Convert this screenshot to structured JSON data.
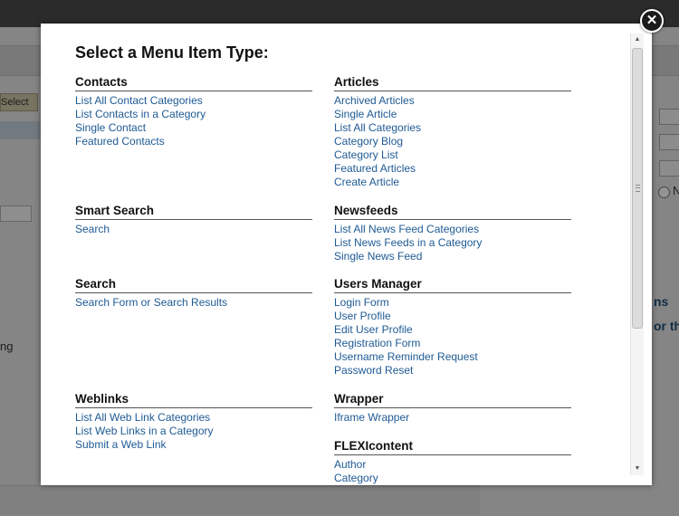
{
  "background": {
    "select_button_label": "Select",
    "left_fragment_text": "ng",
    "right_fragment_1": "ns",
    "right_fragment_2": "or th",
    "radio_label": "N"
  },
  "modal": {
    "title": "Select a Menu Item Type:",
    "close_glyph": "✕",
    "left_column": [
      {
        "heading": "Contacts",
        "items": [
          "List All Contact Categories",
          "List Contacts in a Category",
          "Single Contact",
          "Featured Contacts"
        ]
      },
      {
        "heading": "Smart Search",
        "items": [
          "Search"
        ]
      },
      {
        "heading": "Search",
        "items": [
          "Search Form or Search Results"
        ]
      },
      {
        "heading": "Weblinks",
        "items": [
          "List All Web Link Categories",
          "List Web Links in a Category",
          "Submit a Web Link"
        ]
      }
    ],
    "right_column": [
      {
        "heading": "Articles",
        "items": [
          "Archived Articles",
          "Single Article",
          "List All Categories",
          "Category Blog",
          "Category List",
          "Featured Articles",
          "Create Article"
        ]
      },
      {
        "heading": "Newsfeeds",
        "items": [
          "List All News Feed Categories",
          "List News Feeds in a Category",
          "Single News Feed"
        ]
      },
      {
        "heading": "Users Manager",
        "items": [
          "Login Form",
          "User Profile",
          "Edit User Profile",
          "Registration Form",
          "Username Reminder Request",
          "Password Reset"
        ]
      },
      {
        "heading": "Wrapper",
        "items": [
          "Iframe Wrapper"
        ]
      },
      {
        "heading": "FLEXIcontent",
        "items": [
          "Author",
          "Category"
        ]
      }
    ]
  },
  "scrollbar": {
    "up_glyph": "▲",
    "down_glyph": "▼"
  }
}
